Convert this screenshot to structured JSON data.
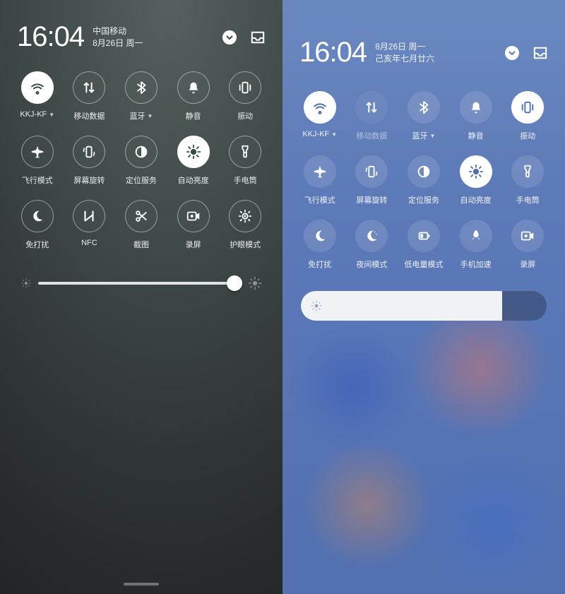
{
  "left": {
    "clock": "16:04",
    "date_line1": "中国移动",
    "date_line2": "8月26日 周一",
    "tiles": [
      {
        "icon": "wifi",
        "label": "KKJ-KF",
        "dropdown": true,
        "active": true
      },
      {
        "icon": "data",
        "label": "移动数据",
        "dropdown": false,
        "active": false
      },
      {
        "icon": "bluetooth",
        "label": "蓝牙",
        "dropdown": true,
        "active": false
      },
      {
        "icon": "bell",
        "label": "静音",
        "dropdown": false,
        "active": false
      },
      {
        "icon": "vibrate",
        "label": "振动",
        "dropdown": false,
        "active": false
      },
      {
        "icon": "airplane",
        "label": "飞行模式",
        "dropdown": false,
        "active": false
      },
      {
        "icon": "rotate",
        "label": "屏幕旋转",
        "dropdown": false,
        "active": false
      },
      {
        "icon": "location",
        "label": "定位服务",
        "dropdown": false,
        "active": false
      },
      {
        "icon": "brightauto",
        "label": "自动亮度",
        "dropdown": false,
        "active": true
      },
      {
        "icon": "flashlight",
        "label": "手电筒",
        "dropdown": false,
        "active": false
      },
      {
        "icon": "moon",
        "label": "免打扰",
        "dropdown": false,
        "active": false
      },
      {
        "icon": "nfc",
        "label": "NFC",
        "dropdown": false,
        "active": false
      },
      {
        "icon": "scissors",
        "label": "截图",
        "dropdown": false,
        "active": false
      },
      {
        "icon": "record",
        "label": "录屏",
        "dropdown": false,
        "active": false
      },
      {
        "icon": "eyecare",
        "label": "护眼模式",
        "dropdown": false,
        "active": false
      }
    ],
    "brightness_percent": 100
  },
  "right": {
    "clock": "16:04",
    "date_line1": "8月26日 周一",
    "date_line2": "己亥年七月廿六",
    "tiles": [
      {
        "icon": "wifi",
        "label": "KKJ-KF",
        "dropdown": true,
        "active": true
      },
      {
        "icon": "data",
        "label": "移动数据",
        "dropdown": false,
        "active": false,
        "dim": true
      },
      {
        "icon": "bluetooth",
        "label": "蓝牙",
        "dropdown": true,
        "active": false
      },
      {
        "icon": "bell",
        "label": "静音",
        "dropdown": false,
        "active": false
      },
      {
        "icon": "vibrate",
        "label": "振动",
        "dropdown": false,
        "active": true
      },
      {
        "icon": "airplane",
        "label": "飞行模式",
        "dropdown": false,
        "active": false
      },
      {
        "icon": "rotate",
        "label": "屏幕旋转",
        "dropdown": false,
        "active": false
      },
      {
        "icon": "location",
        "label": "定位服务",
        "dropdown": false,
        "active": false
      },
      {
        "icon": "brightauto",
        "label": "自动亮度",
        "dropdown": false,
        "active": true
      },
      {
        "icon": "flashlight",
        "label": "手电筒",
        "dropdown": false,
        "active": false
      },
      {
        "icon": "moon",
        "label": "免打扰",
        "dropdown": false,
        "active": false
      },
      {
        "icon": "night",
        "label": "夜间模式",
        "dropdown": false,
        "active": false
      },
      {
        "icon": "battery",
        "label": "低电量模式",
        "dropdown": false,
        "active": false
      },
      {
        "icon": "rocket",
        "label": "手机加速",
        "dropdown": false,
        "active": false
      },
      {
        "icon": "record",
        "label": "录屏",
        "dropdown": false,
        "active": false
      }
    ],
    "brightness_percent": 82
  }
}
